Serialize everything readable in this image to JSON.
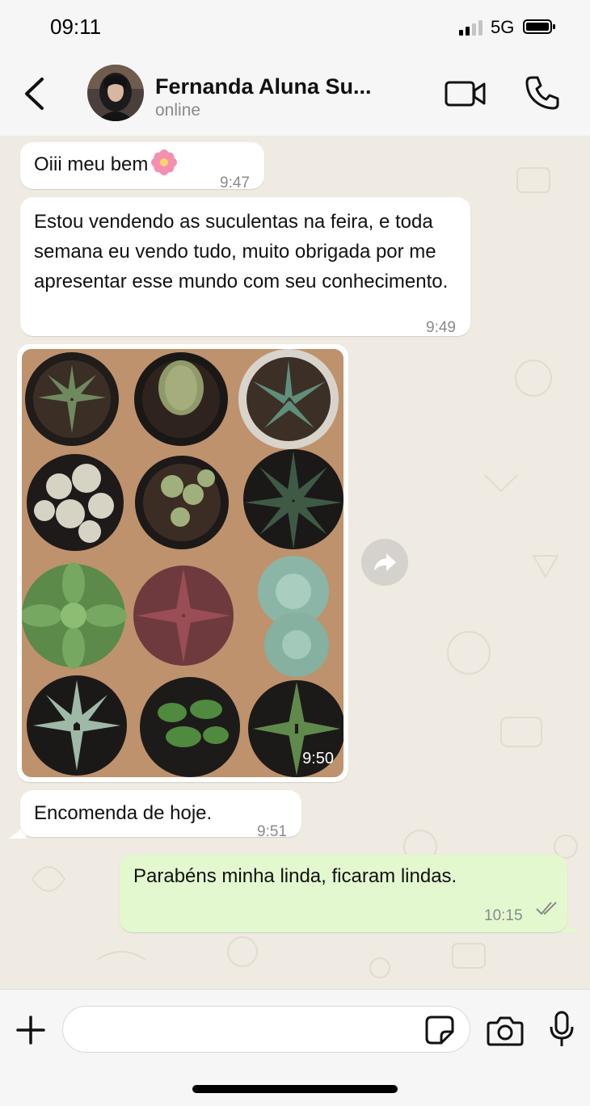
{
  "status_bar": {
    "time": "09:11",
    "network": "5G"
  },
  "header": {
    "contact_name": "Fernanda Aluna Su...",
    "contact_status": "online"
  },
  "messages": [
    {
      "direction": "in",
      "text": "Oiii meu bem",
      "emoji": "pink-flower-emoji",
      "time": "9:47"
    },
    {
      "direction": "in",
      "text": "Estou vendendo as suculentas na feira, e toda semana eu vendo tudo, muito obrigada por me apresentar esse mundo com seu conhecimento.",
      "time": "9:49"
    },
    {
      "direction": "in",
      "type": "image",
      "image": "photo of succulents in pots",
      "time": "9:50"
    },
    {
      "direction": "in",
      "text": "Encomenda de hoje.",
      "time": "9:51"
    },
    {
      "direction": "out",
      "text": "Parabéns minha linda, ficaram lindas.",
      "time": "10:15",
      "status": "read"
    }
  ],
  "input": {
    "placeholder": ""
  },
  "colors": {
    "incoming": "#ffffff",
    "outgoing": "#e3f8cf",
    "background": "#efeae2",
    "read_ticks": "#8a8a8a"
  },
  "icons": [
    "back-arrow-icon",
    "video-call-icon",
    "phone-call-icon",
    "forward-icon",
    "plus-icon",
    "sticker-icon",
    "camera-icon",
    "mic-icon"
  ]
}
